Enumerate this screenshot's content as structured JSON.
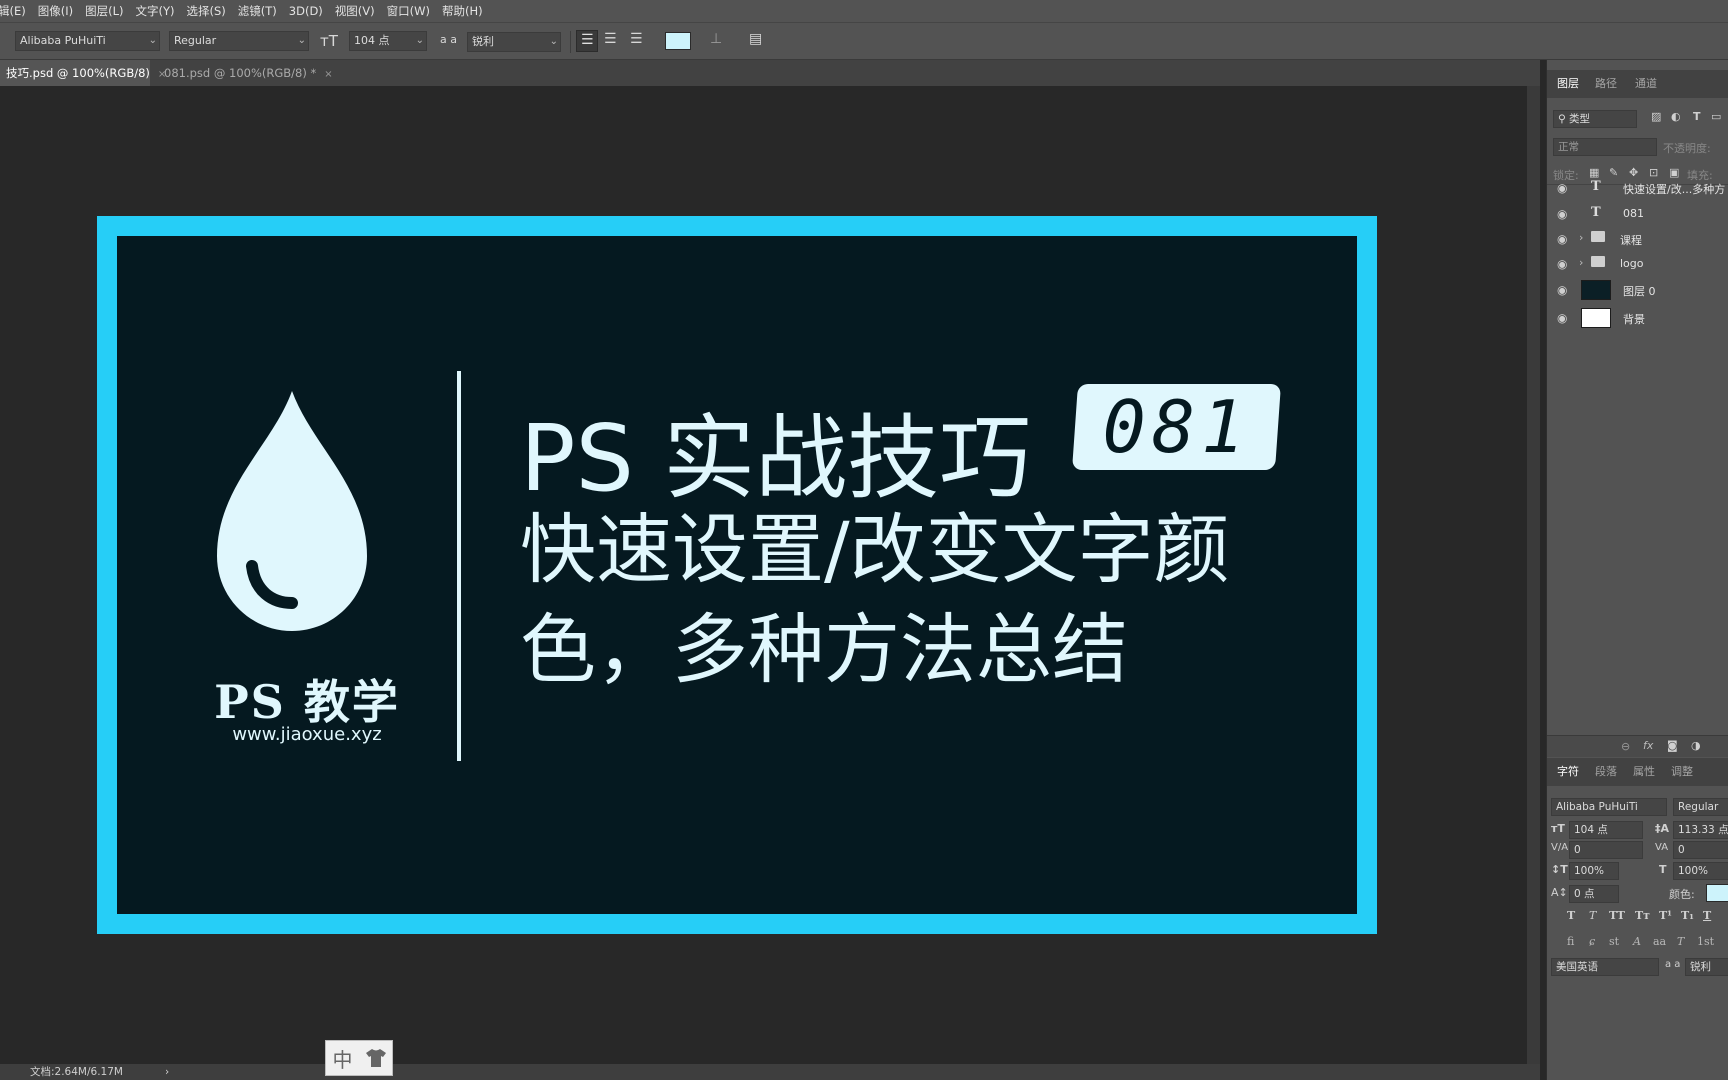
{
  "menu": [
    "辑(E)",
    "图像(I)",
    "图层(L)",
    "文字(Y)",
    "选择(S)",
    "滤镜(T)",
    "3D(D)",
    "视图(V)",
    "窗口(W)",
    "帮助(H)"
  ],
  "options": {
    "font_family": "Alibaba PuHuiTi",
    "font_style": "Regular",
    "font_size": "104 点",
    "antialias_icon_label": "a a",
    "antialias": "锐利",
    "text_color": "#cdf3fb"
  },
  "tabs": [
    {
      "label": "技巧.psd @ 100%(RGB/8)",
      "close": "×"
    },
    {
      "label": "081.psd @ 100%(RGB/8) *",
      "close": "×"
    }
  ],
  "artwork": {
    "logo_title": "PS 教学",
    "logo_url": "www.jiaoxue.xyz",
    "title": "PS 实战技巧",
    "number": "081",
    "subtitle": "快速设置/改变文字颜色，多种方法总结",
    "frame_color": "#26cef7",
    "bg_color": "#051920",
    "text_color": "#e0f7fd"
  },
  "status": {
    "doc": "文档:2.64M/6.17M",
    "arrow": "›"
  },
  "ime": {
    "lang": "中"
  },
  "layers_panel": {
    "tabs": [
      "图层",
      "路径",
      "通道"
    ],
    "filter": "类型",
    "blend": "正常",
    "opacity_label": "不透明度:",
    "lock_label": "锁定:",
    "fill_label": "填充:",
    "layers": [
      {
        "kind": "text",
        "type_glyph": "T",
        "name": "快速设置/改...多种方"
      },
      {
        "kind": "text",
        "type_glyph": "T",
        "name": "081"
      },
      {
        "kind": "group",
        "name": "课程"
      },
      {
        "kind": "group",
        "name": "logo"
      },
      {
        "kind": "pixel",
        "name": "图层 0",
        "thumb": "#0b1f26"
      },
      {
        "kind": "pixel",
        "name": "背景",
        "thumb": "#ffffff"
      }
    ],
    "footer_icons": [
      "link-icon",
      "fx-icon",
      "mask-icon",
      "adjustment-icon"
    ],
    "footer_fx": "fx"
  },
  "char_panel": {
    "tabs": [
      "字符",
      "段落",
      "属性",
      "调整"
    ],
    "font_family": "Alibaba PuHuiTi",
    "font_style": "Regular",
    "size": "104 点",
    "leading": "113.33 点",
    "kerning": "0",
    "tracking": "0",
    "vscale": "100%",
    "hscale": "100%",
    "baseline": "0 点",
    "color_label": "颜色:",
    "color": "#cdf3fb",
    "styles": [
      "T",
      "T",
      "TT",
      "Tт",
      "T¹",
      "T₁",
      "T"
    ],
    "features": [
      "fi",
      "ɕ",
      "st",
      "A",
      "aa",
      "T",
      "1st"
    ],
    "language": "美国英语",
    "aa_label": "a a",
    "antialias": "锐利"
  }
}
